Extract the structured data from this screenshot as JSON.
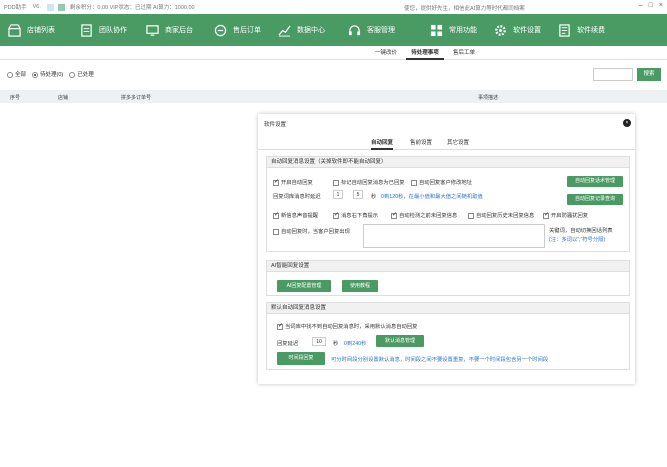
{
  "titlebar": {
    "app": "PDD助手",
    "version": "V6.",
    "points": "剩余积分：0.00 VIP状态：已过期 AI算力：1000.00",
    "notice": "使您，提供好先生，相信此AI算力等时代都同档案"
  },
  "nav": [
    {
      "label": "店铺列表",
      "icon": "store-icon"
    },
    {
      "label": "团队协作",
      "icon": "team-icon"
    },
    {
      "label": "商家后台",
      "icon": "monitor-icon"
    },
    {
      "label": "售后订单",
      "icon": "aftersale-icon"
    },
    {
      "label": "数据中心",
      "icon": "chart-icon"
    },
    {
      "label": "客服管理",
      "icon": "headset-icon"
    },
    {
      "label": "常用功能",
      "icon": "grid-icon",
      "active": true
    },
    {
      "label": "软件设置",
      "icon": "gear-icon"
    },
    {
      "label": "软件续费",
      "icon": "renew-icon"
    }
  ],
  "subtabs": [
    "一键改价",
    "待处理事项",
    "售后工单"
  ],
  "filter": {
    "options": [
      "全部",
      "待处理(0)",
      "已处理"
    ],
    "selected": 1,
    "search_placeholder": "",
    "search_btn": "搜索"
  },
  "table": {
    "headers": [
      "序号",
      "店铺",
      "拼多多订单号",
      "事项描述"
    ]
  },
  "dialog": {
    "title": "软件设置",
    "close": "×",
    "tabs": [
      "自动回复",
      "售前设置",
      "其它设置"
    ],
    "active_tab": 0,
    "auto_reply": {
      "header": "自动回复消息设置（关掉软件即不能自动回复）",
      "cb_enable": "开启自动回复",
      "cb_mark_read": "标记自动回复消息为已回复",
      "cb_auto_modify": "自动回复客户修改地址",
      "btn_lib": "自动回复话术管理",
      "delay_label": "回复词库消息时延迟",
      "delay_min": "1",
      "delay_max": "5",
      "delay_unit": "秒",
      "delay_hint": "0到120秒，在最小值和最大值之间随机取值",
      "btn_log": "自动回复记录查询",
      "cb_new_msg": "新信息声音提醒",
      "cb_msg_tip": "消息右下角提示",
      "cb_auto_check": "自动检测之前未回复信息",
      "cb_auto_reply_history": "自动回复历史未回复信息",
      "cb_dnd": "开启防骚扰回复",
      "cb_keyword": "自动回复时，当客户回复出现",
      "keyword_hint": "关键词，自动切换回话列表",
      "keyword_hint2": "(注：多词以“;”符号分隔)"
    },
    "ai": {
      "header": "AI智能回复设置",
      "btn_config": "AI回复配置管理",
      "btn_tutorial": "使用教程"
    },
    "default": {
      "header": "默认自动回复消息设置",
      "cb_default": "当词库中找不到自动回复消息时，采用默认消息自动回复",
      "delay_label": "回复延迟",
      "delay_value": "10",
      "delay_unit": "秒",
      "delay_hint": "0到240秒",
      "btn_default_lib": "默认消息管理",
      "btn_time": "时间段回复",
      "time_hint": "可分时间段分别设置默认消息，时间段之间不要设置重复，不要一个时间段包含另一个时间段"
    }
  },
  "colors": {
    "brand": "#4a9a63",
    "brand_dark": "#327a4a",
    "link": "#2a73c9"
  }
}
